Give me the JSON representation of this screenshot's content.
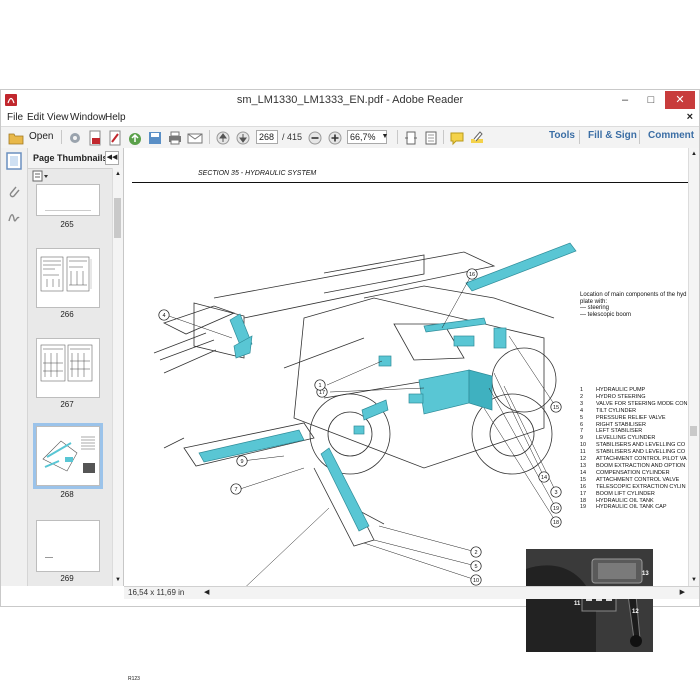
{
  "window": {
    "title": "sm_LM1330_LM1333_EN.pdf - Adobe Reader",
    "controls": {
      "minimize": "–",
      "maximize": "□",
      "close": "✕"
    }
  },
  "menu": [
    "File",
    "Edit",
    "View",
    "Window",
    "Help"
  ],
  "menu_close": "×",
  "toolbar": {
    "open_label": "Open",
    "page_current": "268",
    "page_total": "/ 415",
    "zoom": "66,7%",
    "tools_label": "Tools",
    "fill_sign_label": "Fill & Sign",
    "comment_label": "Comment"
  },
  "thumbnails_panel": {
    "title": "Page Thumbnails",
    "collapse": "◀◀",
    "pages": [
      {
        "number": "265",
        "selected": false
      },
      {
        "number": "266",
        "selected": false
      },
      {
        "number": "267",
        "selected": false
      },
      {
        "number": "268",
        "selected": true
      },
      {
        "number": "269",
        "selected": false
      }
    ]
  },
  "document": {
    "section_title": "SECTION 35 - HYDRAULIC SYSTEM",
    "intro": [
      "Location of main components of the hyd",
      "plate with:",
      "— steering",
      "— telescopic boom"
    ],
    "legend": [
      {
        "n": "1",
        "text": "HYDRAULIC PUMP"
      },
      {
        "n": "2",
        "text": "HYDRO STEERING"
      },
      {
        "n": "3",
        "text": "VALVE FOR STEERING MODE CON"
      },
      {
        "n": "4",
        "text": "TILT CYLINDER"
      },
      {
        "n": "5",
        "text": "PRESSURE RELIEF VALVE"
      },
      {
        "n": "6",
        "text": "RIGHT STABILISER"
      },
      {
        "n": "7",
        "text": "LEFT STABILISER"
      },
      {
        "n": "9",
        "text": "LEVELLING CYLINDER"
      },
      {
        "n": "10",
        "text": "STABILISERS AND LEVELLING CO"
      },
      {
        "n": "11",
        "text": "STABILISERS AND LEVELLING CO"
      },
      {
        "n": "12",
        "text": "ATTACHMENT CONTROL PILOT VA"
      },
      {
        "n": "13",
        "text": "BOOM EXTRACTION AND OPTION"
      },
      {
        "n": "14",
        "text": "COMPENSATION CYLINDER"
      },
      {
        "n": "15",
        "text": "ATTACHMENT CONTROL VALVE"
      },
      {
        "n": "16",
        "text": "TELESCOPIC EXTRACTION CYLIN"
      },
      {
        "n": "17",
        "text": "BOOM LIFT CYLINDER"
      },
      {
        "n": "18",
        "text": "HYDRAULIC OIL TANK"
      },
      {
        "n": "19",
        "text": "HYDRAULIC OIL TANK CAP"
      }
    ],
    "callouts": [
      "4",
      "16",
      "17",
      "1",
      "15",
      "9",
      "7",
      "14",
      "3",
      "19",
      "18",
      "2",
      "5",
      "10",
      "8"
    ],
    "photo_callouts": [
      "13",
      "11",
      "12"
    ],
    "footer_code": "R123"
  },
  "status": {
    "size": "16,54 x 11,69 in"
  },
  "colors": {
    "accent": "#3b6ea5",
    "selection": "#9bc3ea",
    "hydraulic": "#59c6d4",
    "close": "#c83c3c"
  }
}
